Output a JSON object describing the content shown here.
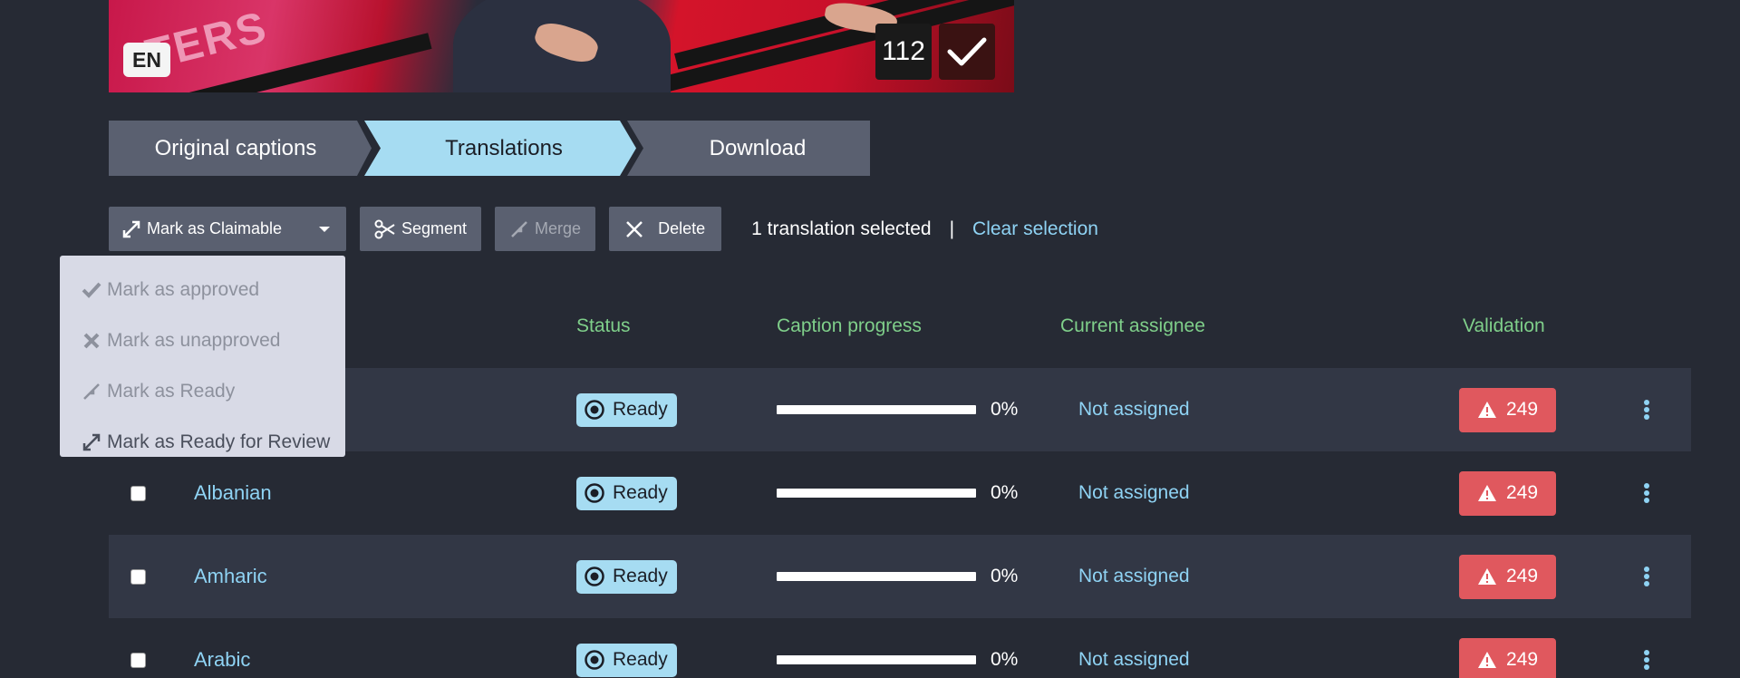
{
  "video": {
    "language_badge": "EN",
    "banner_text": "TERS",
    "caption_count": "112"
  },
  "steps": [
    {
      "label": "Original captions",
      "active": false
    },
    {
      "label": "Translations",
      "active": true
    },
    {
      "label": "Download",
      "active": false
    }
  ],
  "toolbar": {
    "claim_label": "Mark as Claimable",
    "segment_label": "Segment",
    "merge_label": "Merge",
    "delete_label": "Delete",
    "selection_text": "1 translation selected",
    "separator": "|",
    "clear_label": "Clear selection"
  },
  "dropdown": {
    "items": [
      {
        "label": "Mark as approved",
        "icon": "check-icon",
        "enabled": false
      },
      {
        "label": "Mark as unapproved",
        "icon": "x-icon",
        "enabled": false
      },
      {
        "label": "Mark as Ready",
        "icon": "compress-icon",
        "enabled": false
      },
      {
        "label": "Mark as Ready for Review",
        "icon": "expand-icon",
        "enabled": true
      }
    ]
  },
  "table": {
    "headers": {
      "status": "Status",
      "progress": "Caption progress",
      "assignee": "Current assignee",
      "validation": "Validation"
    },
    "rows": [
      {
        "language": "",
        "status": "Ready",
        "progress": 0,
        "progress_text": "0%",
        "assignee": "Not assigned",
        "validation": "249"
      },
      {
        "language": "Albanian",
        "status": "Ready",
        "progress": 0,
        "progress_text": "0%",
        "assignee": "Not assigned",
        "validation": "249"
      },
      {
        "language": "Amharic",
        "status": "Ready",
        "progress": 0,
        "progress_text": "0%",
        "assignee": "Not assigned",
        "validation": "249"
      },
      {
        "language": "Arabic",
        "status": "Ready",
        "progress": 0,
        "progress_text": "0%",
        "assignee": "Not assigned",
        "validation": "249"
      }
    ]
  },
  "colors": {
    "background": "#262a34",
    "accent": "#a6dcf2",
    "link": "#8fd3f4",
    "header": "#7fcf8a",
    "error": "#e0585e"
  }
}
